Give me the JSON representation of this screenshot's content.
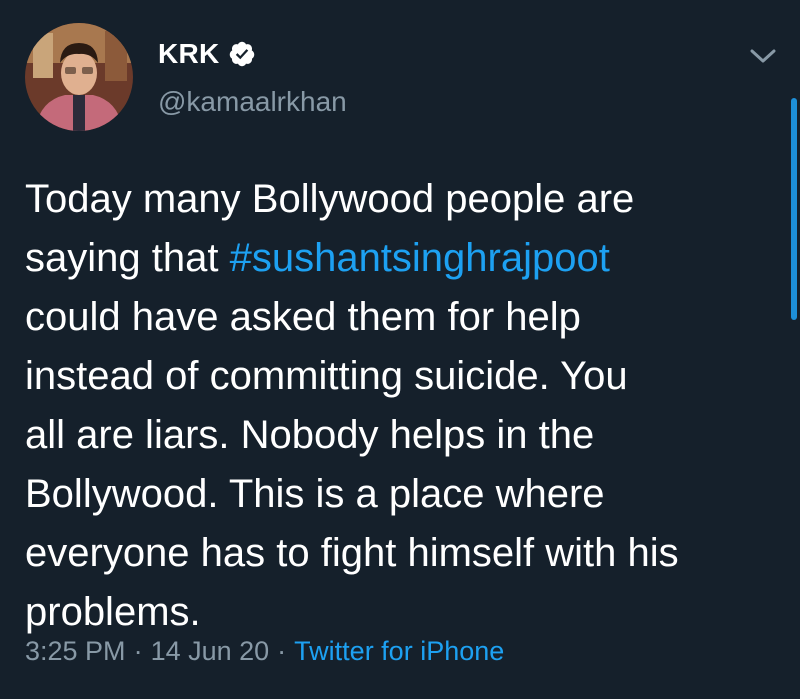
{
  "author": {
    "name": "KRK",
    "handle": "@kamaalrkhan",
    "verified_icon": "verified-badge-icon",
    "avatar": "user-avatar-photo"
  },
  "menu_icon": "chevron-down-icon",
  "tweet": {
    "line1": "Today many Bollywood people are",
    "line2_prefix": "saying that ",
    "hashtag": "#sushantsinghrajpoot",
    "line3": "could have asked them for help",
    "line4": "instead of committing suicide. You",
    "line5": "all are liars. Nobody helps in the",
    "line6": "Bollywood. This is a place where",
    "line7": "everyone has to fight himself with his",
    "line8": "problems."
  },
  "meta": {
    "time": "3:25 PM",
    "separator1": "·",
    "date": "14 Jun 20",
    "separator2": "·",
    "source": "Twitter for iPhone"
  },
  "colors": {
    "background": "#15202b",
    "text": "#ffffff",
    "secondary": "#8899a6",
    "link": "#1da1f2"
  }
}
